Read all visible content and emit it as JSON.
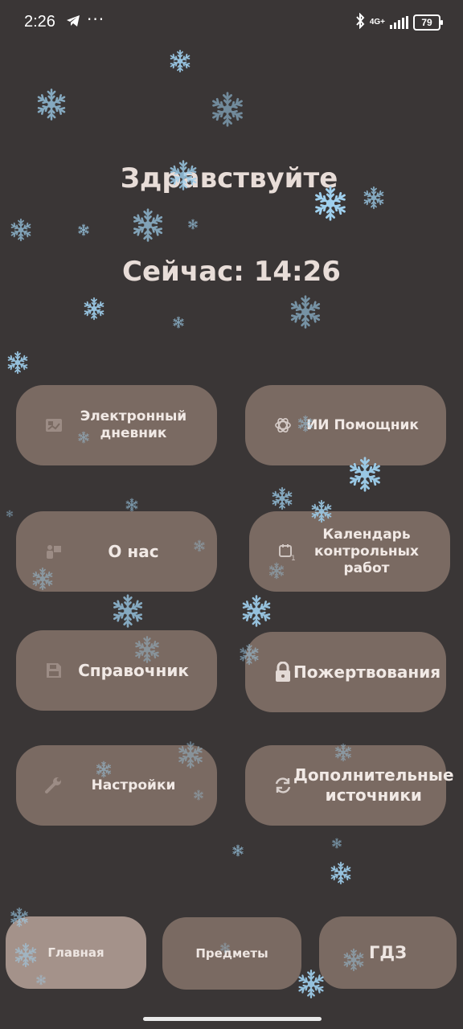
{
  "status_bar": {
    "time": "2:26",
    "network": "4G+",
    "battery": "79"
  },
  "greeting": "Здравствуйте",
  "clock_text": "Сейчас: 14:26",
  "tiles": [
    {
      "label": "Электронный дневник",
      "icon": "diary-icon"
    },
    {
      "label": "ИИ Помощник",
      "icon": "openai-icon"
    },
    {
      "label": "О нас",
      "icon": "person-board-icon"
    },
    {
      "label": "Календарь контрольных работ",
      "icon": "calendar-icon"
    },
    {
      "label": "Справочник",
      "icon": "save-icon"
    },
    {
      "label": "Пожертвования",
      "icon": "lock-icon"
    },
    {
      "label": "Настройки",
      "icon": "wrench-icon"
    },
    {
      "label": "Дополнительные источники",
      "icon": "refresh-icon"
    }
  ],
  "bottom_nav": [
    {
      "label": "Главная",
      "active": true
    },
    {
      "label": "Предметы",
      "active": false
    },
    {
      "label": "ГДЗ",
      "active": false
    }
  ],
  "colors": {
    "background": "#3a3636",
    "tile": "#7a6a62",
    "tile_active": "#a4928a",
    "snowflake": "#9fd0ee"
  },
  "icons": {
    "snowflake": "snowflake-icon",
    "telegram": "telegram-icon",
    "bluetooth": "bluetooth-icon"
  }
}
